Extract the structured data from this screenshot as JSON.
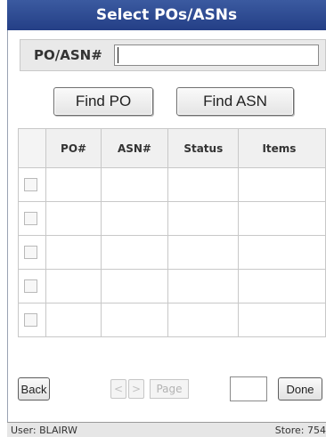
{
  "header": {
    "title": "Select POs/ASNs"
  },
  "search": {
    "label": "PO/ASN#",
    "value": ""
  },
  "actions": {
    "find_po": "Find PO",
    "find_asn": "Find ASN"
  },
  "table": {
    "columns": [
      "",
      "PO#",
      "ASN#",
      "Status",
      "Items"
    ],
    "rows": [
      {
        "checked": false,
        "po": "",
        "asn": "",
        "status": "",
        "items": ""
      },
      {
        "checked": false,
        "po": "",
        "asn": "",
        "status": "",
        "items": ""
      },
      {
        "checked": false,
        "po": "",
        "asn": "",
        "status": "",
        "items": ""
      },
      {
        "checked": false,
        "po": "",
        "asn": "",
        "status": "",
        "items": ""
      },
      {
        "checked": false,
        "po": "",
        "asn": "",
        "status": "",
        "items": ""
      }
    ]
  },
  "footer": {
    "back": "Back",
    "prev_icon": "chevron-left-icon",
    "prev_glyph": "<",
    "next_icon": "chevron-right-icon",
    "next_glyph": ">",
    "page_label": "Page",
    "page_value": "",
    "done": "Done"
  },
  "status_bar": {
    "user": "User: BLAIRW",
    "store": "Store: 754"
  },
  "colors": {
    "title_bar": "#2b4a92",
    "title_text": "#ffffff",
    "header_bg": "#f0f0f0"
  }
}
